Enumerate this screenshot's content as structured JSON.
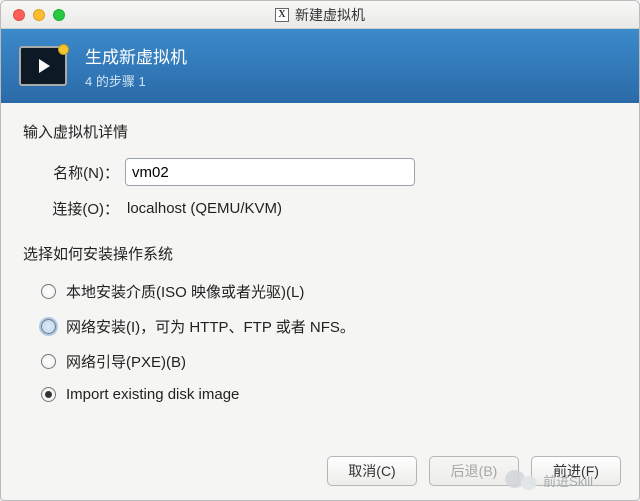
{
  "window": {
    "title": "新建虚拟机"
  },
  "header": {
    "title": "生成新虚拟机",
    "subtitle": "4 的步骤 1"
  },
  "section1": {
    "title": "输入虚拟机详情",
    "name_label": "名称(N)：",
    "name_value": "vm02",
    "conn_label": "连接(O)：",
    "conn_value": "localhost (QEMU/KVM)"
  },
  "section2": {
    "title": "选择如何安装操作系统",
    "options": [
      "本地安装介质(ISO 映像或者光驱)(L)",
      "网络安装(I)，可为 HTTP、FTP 或者 NFS。",
      "网络引导(PXE)(B)",
      "Import existing disk image"
    ],
    "selected_index": 3,
    "hover_index": 1
  },
  "buttons": {
    "cancel": "取消(C)",
    "back": "后退(B)",
    "forward": "前进(F)"
  },
  "watermark": {
    "text": "前进Skill"
  }
}
